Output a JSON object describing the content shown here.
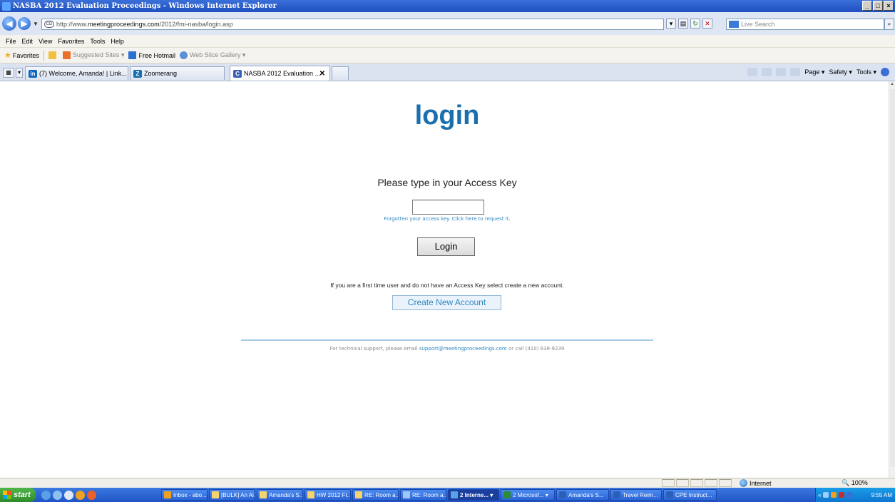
{
  "window": {
    "title": "NASBA 2012 Evaluation Proceedings - Windows Internet Explorer",
    "controls": [
      "_",
      "□",
      "×"
    ]
  },
  "address": {
    "protocol": "http://www.",
    "host": "meetingproceedings.com",
    "path": "/2012/fmi-nasba/login.asp",
    "search_placeholder": "Live Search"
  },
  "menu": [
    "File",
    "Edit",
    "View",
    "Favorites",
    "Tools",
    "Help"
  ],
  "favorites": {
    "label": "Favorites",
    "items": [
      "Suggested Sites ▾",
      "Free Hotmail",
      "Web Slice Gallery ▾"
    ]
  },
  "tabs": [
    {
      "label": "(7) Welcome, Amanda! | Link...",
      "icon": "linkedin-icon",
      "color": "#0a66c2"
    },
    {
      "label": "Zoomerang",
      "icon": "zoomerang-icon",
      "color": "#1a6fae"
    },
    {
      "label": "NASBA 2012 Evaluation ...",
      "icon": "page-icon",
      "color": "#3a63b8",
      "active": true
    }
  ],
  "command_bar": [
    "Page ▾",
    "Safety ▾",
    "Tools ▾"
  ],
  "page": {
    "title": "login",
    "prompt": "Please type in your Access Key",
    "access_key_value": "",
    "forgot_text": "Forgotten your access key. Click here to request it.",
    "login_button": "Login",
    "first_time_text": "If you are a first time user and do not have an Access Key select create a new account.",
    "create_button": "Create New Account",
    "support_prefix": "For technical support, please email ",
    "support_email": "support@meetingproceedings.com",
    "support_suffix": " or call (410) 638-9239"
  },
  "status": {
    "zone": "Internet",
    "zoom": "100%"
  },
  "taskbar": {
    "start": "start",
    "tasks": [
      {
        "label": "Inbox - abo...",
        "color": "#f0a020"
      },
      {
        "label": "[BULK] An Ai...",
        "color": "#f6d36b"
      },
      {
        "label": "Amanda's S...",
        "color": "#f6d36b"
      },
      {
        "label": "HW 2012 Fi...",
        "color": "#f6d36b"
      },
      {
        "label": "RE: Room a...",
        "color": "#f6d36b"
      },
      {
        "label": "RE: Room a...",
        "color": "#9fc6f0"
      },
      {
        "label": "2 Interne... ▾",
        "color": "#5aa0e8",
        "active": true
      },
      {
        "label": "2 Microsof... ▾",
        "color": "#2c8a3a"
      },
      {
        "label": "Amanda's S...",
        "color": "#2b5fb8"
      },
      {
        "label": "Travel Reim...",
        "color": "#2b5fb8"
      },
      {
        "label": "CPE Instruct...",
        "color": "#2b5fb8"
      }
    ],
    "clock": "9:55 AM"
  },
  "colors": {
    "accent": "#1a6fae",
    "link": "#2e86c1",
    "divider": "#a8cbe6"
  }
}
